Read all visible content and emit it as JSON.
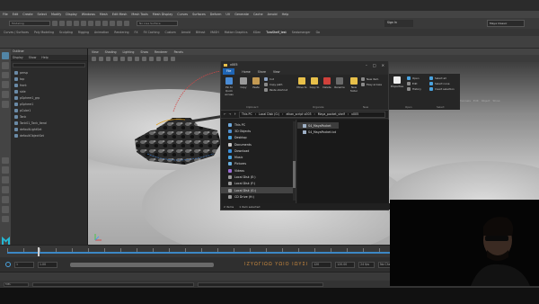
{
  "maya": {
    "menus": [
      "File",
      "Edit",
      "Create",
      "Select",
      "Modify",
      "Display",
      "Windows",
      "Mesh",
      "Edit Mesh",
      "Mesh Tools",
      "Mesh Display",
      "Curves",
      "Surfaces",
      "Deform",
      "UV",
      "Generate",
      "Cache",
      "Arnold",
      "Help"
    ],
    "mode_menu": "Modeling",
    "workspace": "Maya Classic",
    "sign_in": "Sign In",
    "live_field": "No Live Surface",
    "shelf_tabs": [
      "Curves / Surfaces",
      "Poly Modeling",
      "Sculpting",
      "Rigging",
      "Animation",
      "Rendering",
      "FX",
      "FX Caching",
      "Custom",
      "Arnold",
      "Bifrost",
      "MASH",
      "Motion Graphics",
      "XGen",
      "TuraShelf_test",
      "Sealsmanger",
      "Go"
    ],
    "active_shelf": "TuraShelf_test",
    "outliner": {
      "title": "Outliner",
      "menus": [
        "Display",
        "Show",
        "Help"
      ],
      "items": [
        "persp",
        "top",
        "front",
        "side",
        "pSphere1_grp",
        "pSphere1",
        "pCube1",
        "Tank",
        "Tank01_Tank_Iteral",
        "defaultLightSet",
        "defaultObjectSet"
      ]
    },
    "viewport_menus": [
      "View",
      "Shading",
      "Lighting",
      "Show",
      "Renderer",
      "Panels"
    ],
    "channel_tabs": [
      "Channels",
      "Edit",
      "Object",
      "Show"
    ],
    "timeline": {
      "start": "1",
      "end": "120",
      "range_start": "1.00",
      "range_end": "120.00",
      "glyphs": "ΙΖΥΩΓΙΩΩ ΥΩΙΟ ΙΩΥΣΙ",
      "fps": "24 fps",
      "character_set": "No Character Set",
      "anim_layer": "No Anim Layer",
      "progress_fraction": 0.08
    },
    "help_fields": [
      "MEL",
      "",
      ""
    ]
  },
  "explorer": {
    "title": "v005",
    "tabs": [
      "File",
      "Home",
      "Share",
      "View"
    ],
    "ribbon": {
      "pin_label": "Pin to Quick access",
      "copy_label": "Copy",
      "paste_label": "Paste",
      "cut_label": "Cut",
      "copy_path_label": "Copy path",
      "paste_shortcut_label": "Paste shortcut",
      "move_to_label": "Move to",
      "copy_to_label": "Copy to",
      "delete_label": "Delete",
      "rename_label": "Rename",
      "new_folder_label": "New folder",
      "new_item_label": "New item",
      "easy_access_label": "Easy access",
      "properties_label": "Properties",
      "open_label": "Open",
      "edit_label": "Edit",
      "history_label": "History",
      "select_all_label": "Select all",
      "select_none_label": "Select none",
      "invert_label": "Invert selection",
      "groups": [
        "Clipboard",
        "Organize",
        "New",
        "Open",
        "Select"
      ]
    },
    "breadcrumb": [
      "This PC",
      "Local Disk (G:)",
      "elkan_script v003",
      "Maya_pocket_shelf",
      "v005"
    ],
    "nav": [
      {
        "label": "This PC",
        "color": "#6fa9dc"
      },
      {
        "label": "3D Objects",
        "color": "#4f8fd0"
      },
      {
        "label": "Desktop",
        "color": "#4aa3df"
      },
      {
        "label": "Documents",
        "color": "#c9c9c9"
      },
      {
        "label": "Download",
        "color": "#3a8edb"
      },
      {
        "label": "Music",
        "color": "#4aa3df"
      },
      {
        "label": "Pictures",
        "color": "#6ab0df"
      },
      {
        "label": "Videos",
        "color": "#9b6bd6"
      },
      {
        "label": "Local Disk (E:)",
        "color": "#9a9a9a"
      },
      {
        "label": "Local Disk (F:)",
        "color": "#9a9a9a"
      },
      {
        "label": "Local Disk (G:)",
        "color": "#9a9a9a"
      },
      {
        "label": "CD Drive (H:)",
        "color": "#9a9a9a"
      }
    ],
    "selected_nav": "Local Disk (G:)",
    "files": [
      "S4_MayaPocket",
      "S4_MayaPocket.txt"
    ],
    "status": {
      "items": "2 items",
      "selected": "1 item selected"
    }
  }
}
